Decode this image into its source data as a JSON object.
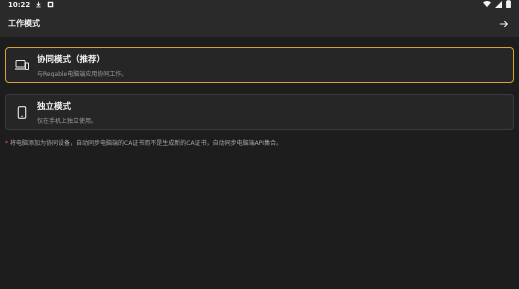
{
  "status_bar": {
    "time": "10:22",
    "icons": [
      "download-icon",
      "notification-icon",
      "wifi-icon",
      "signal-icon",
      "battery-icon"
    ]
  },
  "app_bar": {
    "title": "工作模式",
    "next_icon": "arrow-right-icon"
  },
  "modes": [
    {
      "title": "协同模式（推荐）",
      "description": "与Reqable电脑端应用协同工作。",
      "icon": "laptop-phone-icon",
      "selected": true
    },
    {
      "title": "独立模式",
      "description": "仅在手机上独立使用。",
      "icon": "phone-icon",
      "selected": false
    }
  ],
  "note": {
    "marker": "*",
    "text": "将电脑添加为协同设备，自动同步电脑端的CA证书而不是生成新的CA证书，自动同步电脑端API集合。"
  },
  "colors": {
    "background": "#1d1d1d",
    "bar": "#2a2a2a",
    "card": "#262626",
    "accent_border": "#d9a233",
    "marker": "#e25c4f"
  }
}
